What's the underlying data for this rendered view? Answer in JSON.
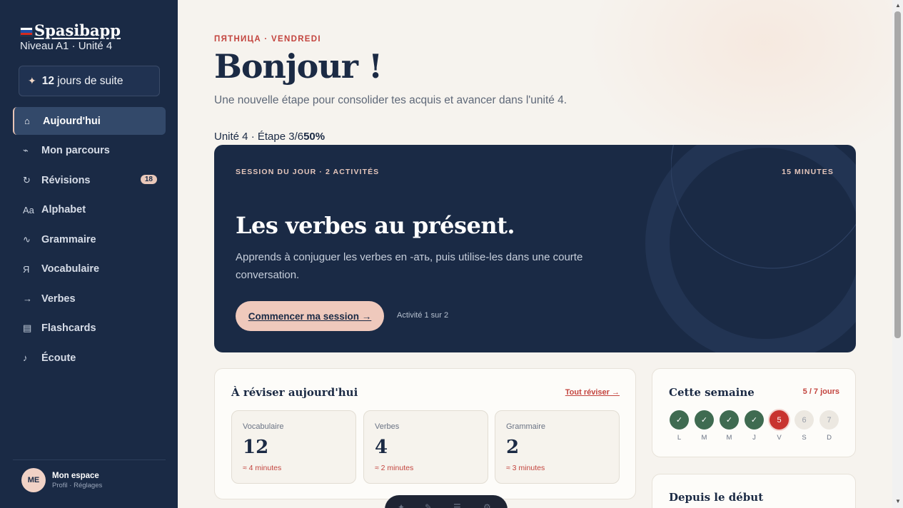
{
  "brand": {
    "name": "Spasibapp",
    "level": "Niveau A1 · Unité 4",
    "flag_colors": [
      "#ffffff",
      "#1f4fa8",
      "#d52b1e"
    ]
  },
  "streak": {
    "icon": "sparkle-icon",
    "count": "12",
    "label": "jours de suite"
  },
  "nav": [
    {
      "icon": "⌂",
      "icon_name": "home-icon",
      "label": "Aujourd'hui",
      "active": true
    },
    {
      "icon": "⌁",
      "icon_name": "path-icon",
      "label": "Mon parcours"
    },
    {
      "icon": "↻",
      "icon_name": "refresh-icon",
      "label": "Révisions",
      "badge": "18"
    },
    {
      "icon": "Aa",
      "icon_name": "alphabet-icon",
      "label": "Alphabet"
    },
    {
      "icon": "∿",
      "icon_name": "grammar-icon",
      "label": "Grammaire"
    },
    {
      "icon": "Я",
      "icon_name": "cyrillic-letter-icon",
      "label": "Vocabulaire"
    },
    {
      "icon": "→",
      "icon_name": "arrow-right-icon",
      "label": "Verbes"
    },
    {
      "icon": "▤",
      "icon_name": "cards-icon",
      "label": "Flashcards"
    },
    {
      "icon": "♪",
      "icon_name": "music-note-icon",
      "label": "Écoute"
    }
  ],
  "profile": {
    "initials": "ME",
    "name": "Mon espace",
    "sub": "Profil · Réglages"
  },
  "header": {
    "eyebrow": "ПЯТНИЦА · VENDREDI",
    "title": "Bonjour !",
    "subtitle": "Une nouvelle étape pour consolider tes acquis et avancer dans l'unité 4.",
    "progress_text": "Unité 4 · Étape 3/6",
    "progress_pct": "50%",
    "progress_value": 0.5
  },
  "session": {
    "label": "SESSION DU JOUR · 2 ACTIVITÉS",
    "duration": "15 MINUTES",
    "title": "Les verbes au présent.",
    "description": "Apprends à conjuguer les verbes en -ать, puis utilise-les dans une courte conversation.",
    "cta": "Commencer ma session →",
    "cta_note": "Activité 1 sur 2"
  },
  "review": {
    "title": "À réviser aujourd'hui",
    "link": "Tout réviser →",
    "tiles": [
      {
        "label": "Vocabulaire",
        "count": "12",
        "time": "≈ 4 minutes"
      },
      {
        "label": "Verbes",
        "count": "4",
        "time": "≈ 2 minutes"
      },
      {
        "label": "Grammaire",
        "count": "2",
        "time": "≈ 3 minutes"
      }
    ]
  },
  "week": {
    "title": "Cette semaine",
    "count": "5 / 7 jours",
    "days": [
      {
        "letter": "L",
        "mark": "✓",
        "state": "done"
      },
      {
        "letter": "M",
        "mark": "✓",
        "state": "done"
      },
      {
        "letter": "M",
        "mark": "✓",
        "state": "done"
      },
      {
        "letter": "J",
        "mark": "✓",
        "state": "done"
      },
      {
        "letter": "V",
        "mark": "5",
        "state": "today"
      },
      {
        "letter": "S",
        "mark": "6",
        "state": "todo"
      },
      {
        "letter": "D",
        "mark": "7",
        "state": "todo"
      }
    ]
  },
  "since": {
    "title": "Depuis le début"
  },
  "colors": {
    "navy": "#1a2a45",
    "accent_red": "#c3443e",
    "peach": "#efc9bc",
    "success_green": "#3f6b51"
  }
}
